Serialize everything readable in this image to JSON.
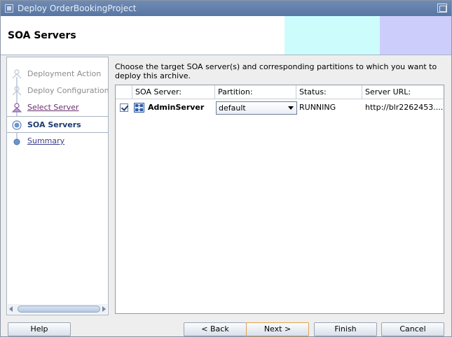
{
  "window": {
    "title": "Deploy OrderBookingProject"
  },
  "header": {
    "title": "SOA Servers"
  },
  "nav": {
    "items": [
      {
        "label": "Deployment Action",
        "state": "done"
      },
      {
        "label": "Deploy Configuration",
        "state": "done"
      },
      {
        "label": "Select Server",
        "state": "visited"
      },
      {
        "label": "SOA Servers",
        "state": "active"
      },
      {
        "label": "Summary",
        "state": "link"
      }
    ]
  },
  "main": {
    "instructions": "Choose the target SOA server(s) and corresponding partitions to which you want to deploy this archive.",
    "columns": [
      "SOA Server:",
      "Partition:",
      "Status:",
      "Server URL:"
    ],
    "rows": [
      {
        "checked": true,
        "server": "AdminServer",
        "partition": "default",
        "status": "RUNNING",
        "url": "http://blr2262453...."
      }
    ]
  },
  "buttons": {
    "help": "Help",
    "back": "< Back",
    "next": "Next >",
    "finish": "Finish",
    "cancel": "Cancel"
  },
  "colors": {
    "titlebar": "#5e7ba8",
    "header_cyan": "#ccfcfc",
    "header_lavender": "#cdcdfb",
    "active_text": "#1c3c73",
    "link_text": "#3a3f8c"
  }
}
